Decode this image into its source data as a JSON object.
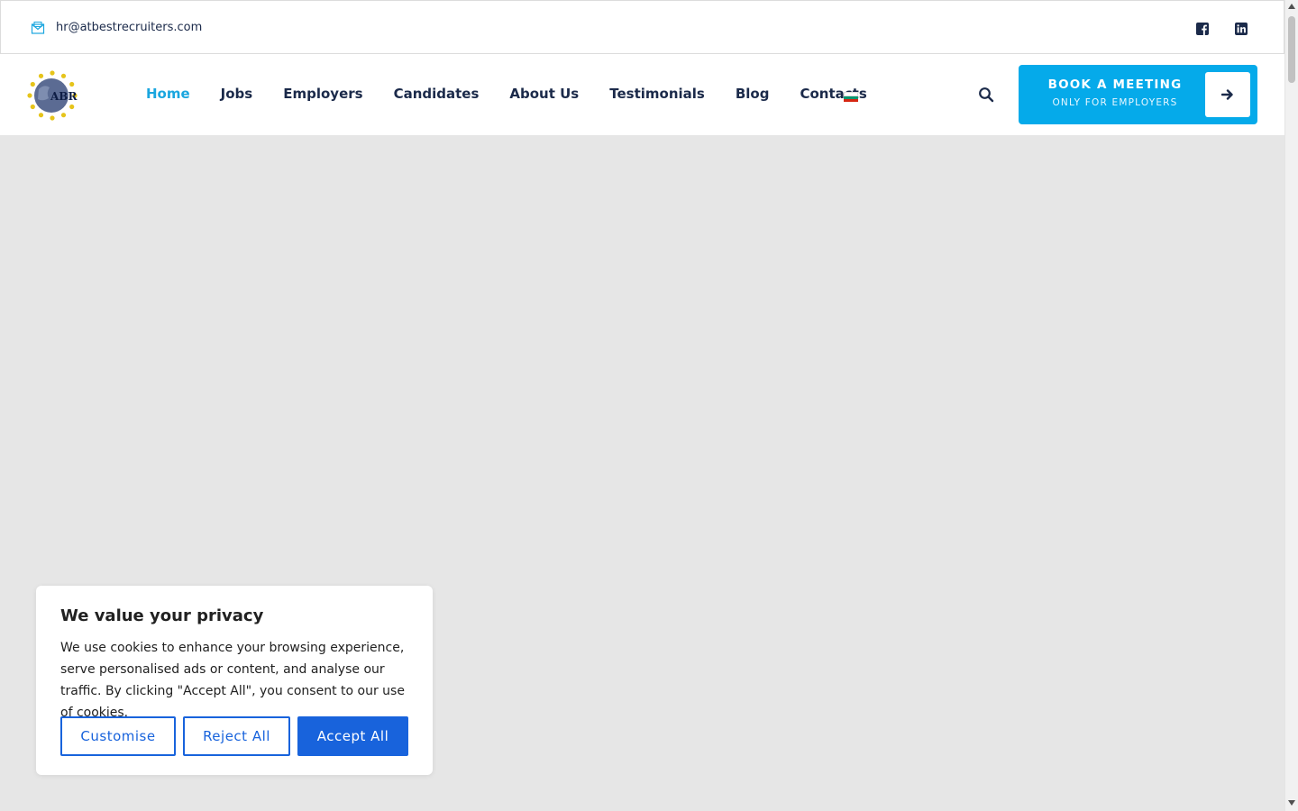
{
  "topbar": {
    "email": "hr@atbestrecruiters.com",
    "mail_icon": "mail-icon",
    "social": [
      {
        "name": "facebook-icon"
      },
      {
        "name": "linkedin-icon"
      }
    ]
  },
  "header": {
    "logo_text": "ABR",
    "nav": [
      {
        "label": "Home",
        "active": true
      },
      {
        "label": "Jobs"
      },
      {
        "label": "Employers"
      },
      {
        "label": "Candidates"
      },
      {
        "label": "About Us"
      },
      {
        "label": "Testimonials"
      },
      {
        "label": "Blog"
      },
      {
        "label": "Contacts"
      }
    ],
    "flag_colors": [
      "#ffffff",
      "#00966e",
      "#d62612"
    ],
    "cta": {
      "title": "BOOK A MEETING",
      "subtitle": "ONLY FOR EMPLOYERS"
    }
  },
  "cookie": {
    "title": "We value your privacy",
    "text": "We use cookies to enhance your browsing experience, serve personalised ads or content, and analyse our traffic. By clicking \"Accept All\", you consent to our use of cookies.",
    "customise": "Customise",
    "reject": "Reject All",
    "accept": "Accept All"
  },
  "colors": {
    "accent": "#1aa6df",
    "cta": "#05aaea",
    "cookie_button": "#1863dc",
    "navy": "#1b2a4a"
  }
}
